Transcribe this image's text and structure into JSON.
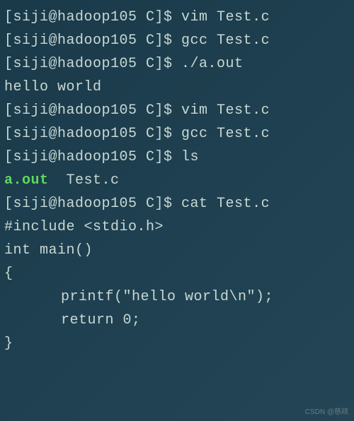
{
  "lines": [
    {
      "type": "cmd",
      "prompt": "[siji@hadoop105 C]$ ",
      "command": "vim Test.c"
    },
    {
      "type": "cmd",
      "prompt": "[siji@hadoop105 C]$ ",
      "command": "gcc Test.c"
    },
    {
      "type": "cmd",
      "prompt": "[siji@hadoop105 C]$ ",
      "command": "./a.out"
    },
    {
      "type": "output",
      "text": "hello world"
    },
    {
      "type": "cmd",
      "prompt": "[siji@hadoop105 C]$ ",
      "command": "vim Test.c"
    },
    {
      "type": "cmd",
      "prompt": "[siji@hadoop105 C]$ ",
      "command": "gcc Test.c"
    },
    {
      "type": "cmd",
      "prompt": "[siji@hadoop105 C]$ ",
      "command": "ls"
    },
    {
      "type": "ls",
      "exec": "a.out",
      "rest": "  Test.c"
    },
    {
      "type": "cmd",
      "prompt": "[siji@hadoop105 C]$ ",
      "command": "cat Test.c"
    },
    {
      "type": "output",
      "text": "#include <stdio.h>"
    },
    {
      "type": "output",
      "text": "int main()"
    },
    {
      "type": "output",
      "text": "{"
    },
    {
      "type": "output-indent",
      "text": "printf(\"hello world\\n\");"
    },
    {
      "type": "output-indent",
      "text": "return 0;"
    },
    {
      "type": "output",
      "text": "}"
    }
  ],
  "watermark": "CSDN @慈疏"
}
